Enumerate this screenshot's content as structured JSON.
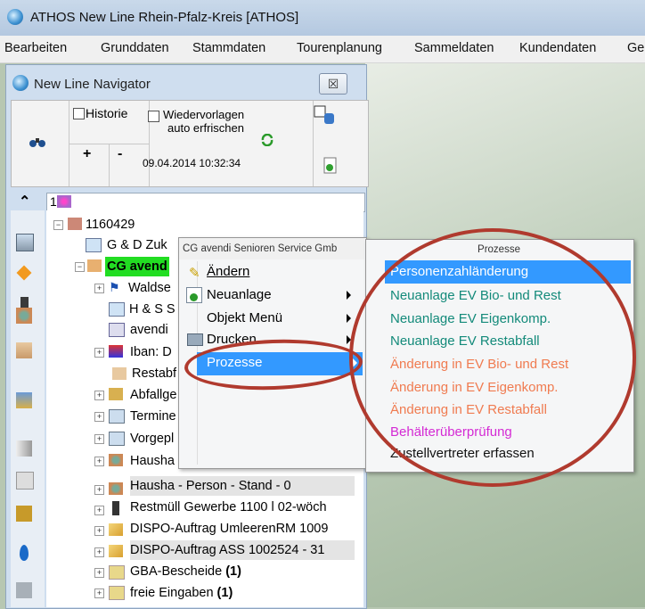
{
  "window": {
    "title": "ATHOS New Line Rhein-Pfalz-Kreis  [ATHOS]"
  },
  "menubar": [
    "Bearbeiten",
    "Grunddaten",
    "Stammdaten",
    "Tourenplanung",
    "Sammeldaten",
    "Kundendaten",
    "Ge"
  ],
  "navigator": {
    "title": "New Line Navigator",
    "close_label": "☒",
    "historie_label": "Historie",
    "wiedervorlagen_label_1": "Wiedervorlagen",
    "wiedervorlagen_label_2": "auto erfrischen",
    "plus_label": "+",
    "minus_label": "-",
    "datetime": "09.04.2014 10:32:34",
    "tree_header": "1"
  },
  "tree": {
    "root": "1160429",
    "rows": [
      "G & D Zuk",
      "CG avend",
      "Waldse",
      "H & S S",
      "avendi",
      "Iban: D",
      "Restabf",
      "Abfallge",
      "Termine",
      "Vorgepl",
      "Hausha - Person - Stand -  1",
      "Hausha - Person - Stand -  0",
      "Restmüll Gewerbe 1100 l 02-wöch",
      "DISPO-Auftrag UmleerenRM 1009",
      "DISPO-Auftrag ASS 1002524 - 31",
      "GBA-Bescheide",
      "freie Eingaben"
    ],
    "count_gba": "(1)",
    "count_freie": "(1)"
  },
  "context_menu": {
    "header": "CG avendi Senioren Service Gmb",
    "items": [
      "Ändern",
      "Neuanlage",
      "Objekt Menü",
      "Drucken",
      "Prozesse"
    ]
  },
  "submenu": {
    "header": "Prozesse",
    "items": [
      {
        "label": "Personenzahländerung",
        "color": "#ffffff"
      },
      {
        "label": "Neuanlage EV Bio- und Rest",
        "color": "#138a7a"
      },
      {
        "label": "Neuanlage EV Eigenkomp.",
        "color": "#138a7a"
      },
      {
        "label": "Neuanlage EV Restabfall",
        "color": "#138a7a"
      },
      {
        "label": "Änderung in EV Bio- und Rest",
        "color": "#f07b50"
      },
      {
        "label": "Änderung in EV Eigenkomp.",
        "color": "#f07b50"
      },
      {
        "label": "Änderung in EV Restabfall",
        "color": "#f07b50"
      },
      {
        "label": "Behälterüberprüfung",
        "color": "#d42ad4"
      },
      {
        "label": "Zustellvertreter erfassen",
        "color": "#111111"
      }
    ]
  },
  "colors": {
    "highlight": "#3399ff",
    "selected_node_bg": "#22dd22",
    "annotation": "#b03a2e"
  }
}
